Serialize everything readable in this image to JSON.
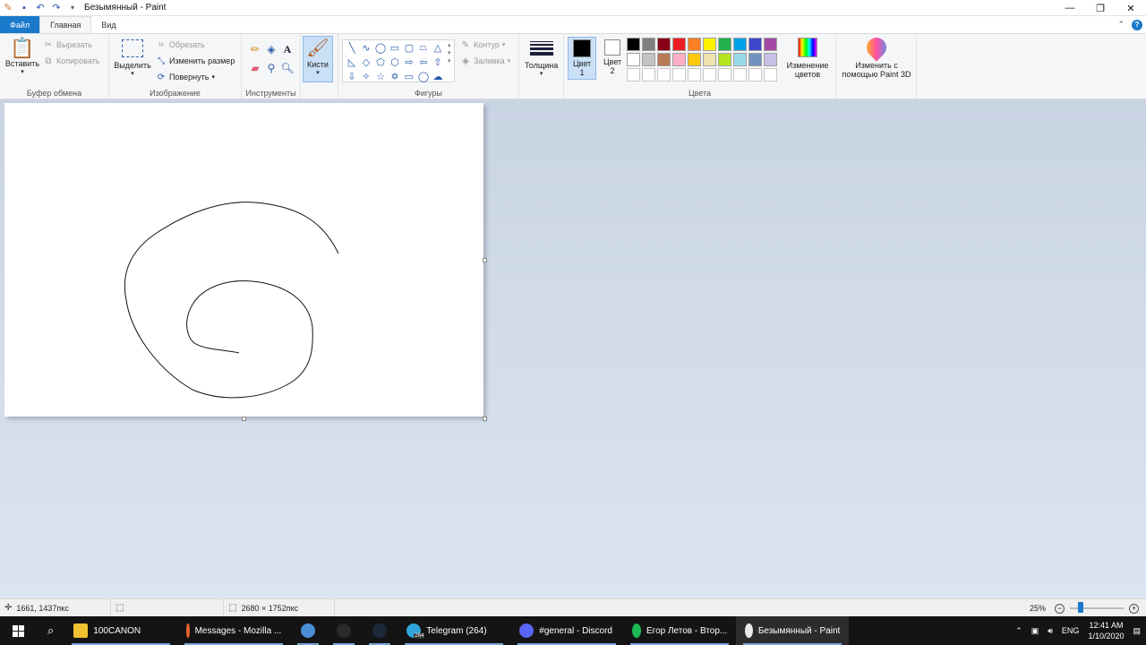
{
  "window": {
    "title": "Безымянный - Paint"
  },
  "tabs": {
    "file": "Файл",
    "home": "Главная",
    "view": "Вид"
  },
  "clipboard": {
    "paste": "Вставить",
    "cut": "Вырезать",
    "copy": "Копировать",
    "group_label": "Буфер обмена"
  },
  "image": {
    "select": "Выделить",
    "crop": "Обрезать",
    "resize": "Изменить размер",
    "rotate": "Повернуть",
    "group_label": "Изображение"
  },
  "tools": {
    "group_label": "Инструменты"
  },
  "brushes": {
    "label": "Кисти"
  },
  "shapes": {
    "outline": "Контур",
    "fill": "Заливка",
    "group_label": "Фигуры"
  },
  "size": {
    "label": "Толщина"
  },
  "colors": {
    "color1_label": "Цвет 1",
    "color2_label": "Цвет 2",
    "color1": "#000000",
    "color2": "#ffffff",
    "edit_colors": "Изменение цветов",
    "group_label": "Цвета",
    "palette": [
      "#000000",
      "#7f7f7f",
      "#880015",
      "#ed1c24",
      "#ff7f27",
      "#fff200",
      "#22b14c",
      "#00a2e8",
      "#3f48cc",
      "#a349a4",
      "#ffffff",
      "#c3c3c3",
      "#b97a57",
      "#ffaec9",
      "#ffc90e",
      "#efe4b0",
      "#b5e61d",
      "#99d9ea",
      "#7092be",
      "#c8bfe7",
      "#ffffff",
      "#ffffff",
      "#ffffff",
      "#ffffff",
      "#ffffff",
      "#ffffff",
      "#ffffff",
      "#ffffff",
      "#ffffff",
      "#ffffff"
    ]
  },
  "paint3d": {
    "label": "Изменить с помощью Paint 3D"
  },
  "status": {
    "cursor_pos": "1661, 1437пкс",
    "image_size": "2680 × 1752пкс",
    "zoom": "25%",
    "zoom_level": 0.25
  },
  "taskbar": {
    "items": [
      {
        "label": "100CANON",
        "icon": "folder-icon",
        "color": "#f0c02e"
      },
      {
        "label": "Messages - Mozilla ...",
        "icon": "firefox-icon",
        "color": "#e8622c"
      },
      {
        "label": "",
        "icon": "qbittorrent-icon",
        "color": "#4a8ed8"
      },
      {
        "label": "",
        "icon": "epic-games-icon",
        "color": "#2a2a2a"
      },
      {
        "label": "",
        "icon": "steam-icon",
        "color": "#1b2838"
      },
      {
        "label": "Telegram (264)",
        "icon": "telegram-icon",
        "color": "#2ea6da"
      },
      {
        "label": "#general - Discord",
        "icon": "discord-icon",
        "color": "#5865f2"
      },
      {
        "label": "Егор Летов - Втор...",
        "icon": "spotify-icon",
        "color": "#1db954"
      },
      {
        "label": "Безымянный - Paint",
        "icon": "paint-icon",
        "color": "#e9e9e9"
      }
    ],
    "language": "ENG",
    "time": "12:41 AM",
    "date": "1/10/2020",
    "telegram_badge": "264"
  }
}
